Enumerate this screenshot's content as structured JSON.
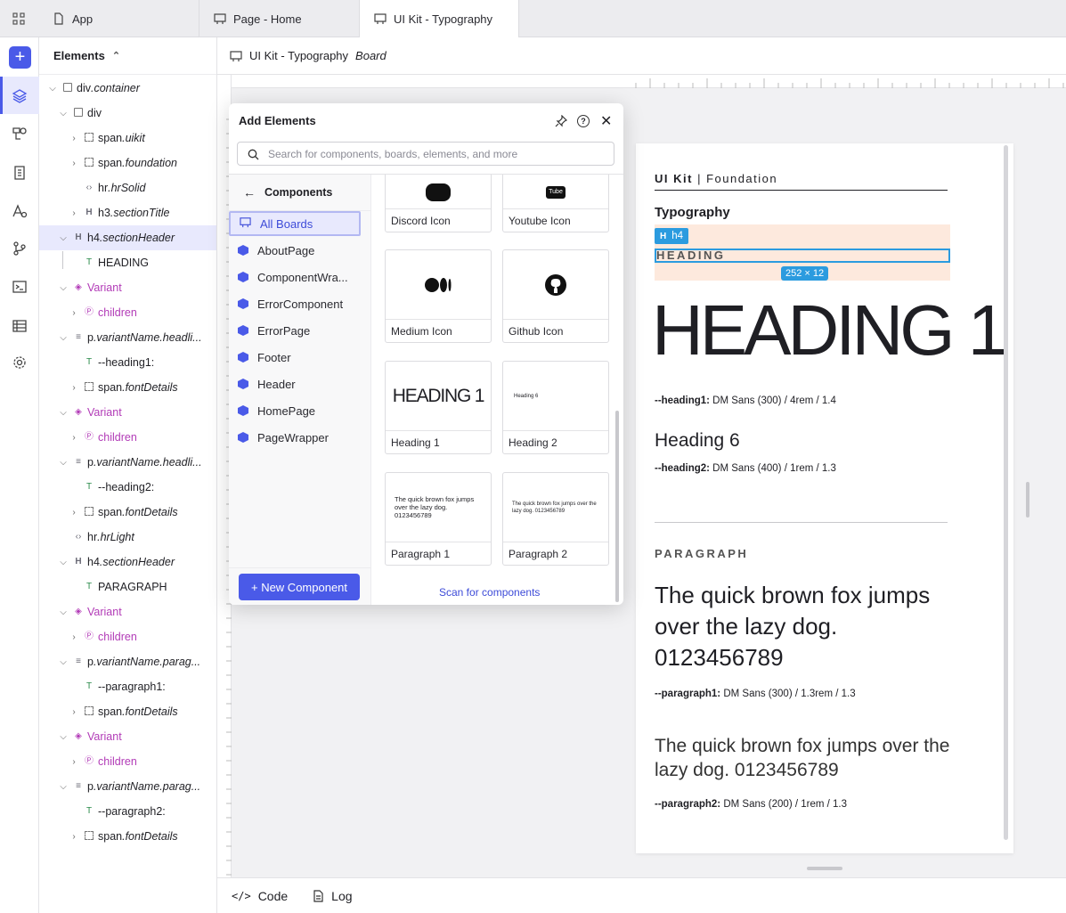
{
  "tabs": [
    {
      "label": "App"
    },
    {
      "label": "Page - Home"
    },
    {
      "label": "UI Kit - Typography"
    }
  ],
  "rail": {
    "add_label": "+"
  },
  "elements_panel": {
    "title": "Elements",
    "rows": [
      {
        "text": "div",
        "suffix": ".container"
      },
      {
        "text": "div",
        "suffix": ""
      },
      {
        "text": "span",
        "suffix": ".uikit"
      },
      {
        "text": "span",
        "suffix": ".foundation"
      },
      {
        "text": "hr",
        "suffix": ".hrSolid"
      },
      {
        "text": "h3",
        "suffix": ".sectionTitle"
      },
      {
        "text": "h4",
        "suffix": ".sectionHeader"
      },
      {
        "text": "HEADING",
        "suffix": ""
      },
      {
        "text": "Variant",
        "suffix": ""
      },
      {
        "text": "children",
        "suffix": ""
      },
      {
        "text": "p",
        "suffix": ".variantName.headli..."
      },
      {
        "text": "--heading1:",
        "suffix": ""
      },
      {
        "text": "span",
        "suffix": ".fontDetails"
      },
      {
        "text": "Variant",
        "suffix": ""
      },
      {
        "text": "children",
        "suffix": ""
      },
      {
        "text": "p",
        "suffix": ".variantName.headli..."
      },
      {
        "text": "--heading2:",
        "suffix": ""
      },
      {
        "text": "span",
        "suffix": ".fontDetails"
      },
      {
        "text": "hr",
        "suffix": ".hrLight"
      },
      {
        "text": "h4",
        "suffix": ".sectionHeader"
      },
      {
        "text": "PARAGRAPH",
        "suffix": ""
      },
      {
        "text": "Variant",
        "suffix": ""
      },
      {
        "text": "children",
        "suffix": ""
      },
      {
        "text": "p",
        "suffix": ".variantName.parag..."
      },
      {
        "text": "--paragraph1:",
        "suffix": ""
      },
      {
        "text": "span",
        "suffix": ".fontDetails"
      },
      {
        "text": "Variant",
        "suffix": ""
      },
      {
        "text": "children",
        "suffix": ""
      },
      {
        "text": "p",
        "suffix": ".variantName.parag..."
      },
      {
        "text": "--paragraph2:",
        "suffix": ""
      },
      {
        "text": "span",
        "suffix": ".fontDetails"
      }
    ]
  },
  "canvas": {
    "title": "UI Kit - Typography",
    "title_suffix": "Board"
  },
  "board": {
    "brand_bold": "UI Kit",
    "brand_sep": " | ",
    "brand_rest": "Foundation",
    "section_title": "Typography",
    "tag": "h4",
    "heading_label": "HEADING",
    "size_badge": "252 × 12",
    "heading1": "HEADING 1",
    "heading1_var": "--heading1:",
    "heading1_details": " DM Sans (300) / 4rem / 1.4",
    "heading6": "Heading 6",
    "heading2_var": "--heading2:",
    "heading2_details": " DM Sans (400) / 1rem / 1.3",
    "paragraph_label": "PARAGRAPH",
    "para1": "The quick brown fox jumps over the lazy dog. 0123456789",
    "para1_var": "--paragraph1:",
    "para1_details": " DM Sans (300) / 1.3rem / 1.3",
    "para2": "The quick brown fox jumps over the lazy dog. 0123456789",
    "para2_var": "--paragraph2:",
    "para2_details": " DM Sans (200) / 1rem / 1.3"
  },
  "modal": {
    "title": "Add Elements",
    "search_placeholder": "Search for components, boards, elements, and more",
    "back_label": "Components",
    "categories": [
      "All Boards",
      "AboutPage",
      "ComponentWra...",
      "ErrorComponent",
      "ErrorPage",
      "Footer",
      "Header",
      "HomePage",
      "PageWrapper"
    ],
    "new_component": "+ New Component",
    "scan_label": "Scan for components",
    "cards": [
      {
        "label": "Discord Icon"
      },
      {
        "label": "Youtube Icon"
      },
      {
        "label": "Medium Icon"
      },
      {
        "label": "Github Icon"
      },
      {
        "label": "Heading 1",
        "preview": "HEADING 1"
      },
      {
        "label": "Heading 2",
        "preview": "Heading 6"
      },
      {
        "label": "Paragraph 1",
        "preview": "The quick brown fox jumps over the lazy dog. 0123456789"
      },
      {
        "label": "Paragraph 2",
        "preview": "The quick brown fox jumps over the lazy dog. 0123456789"
      }
    ]
  },
  "bottombar": {
    "code": "Code",
    "log": "Log"
  }
}
